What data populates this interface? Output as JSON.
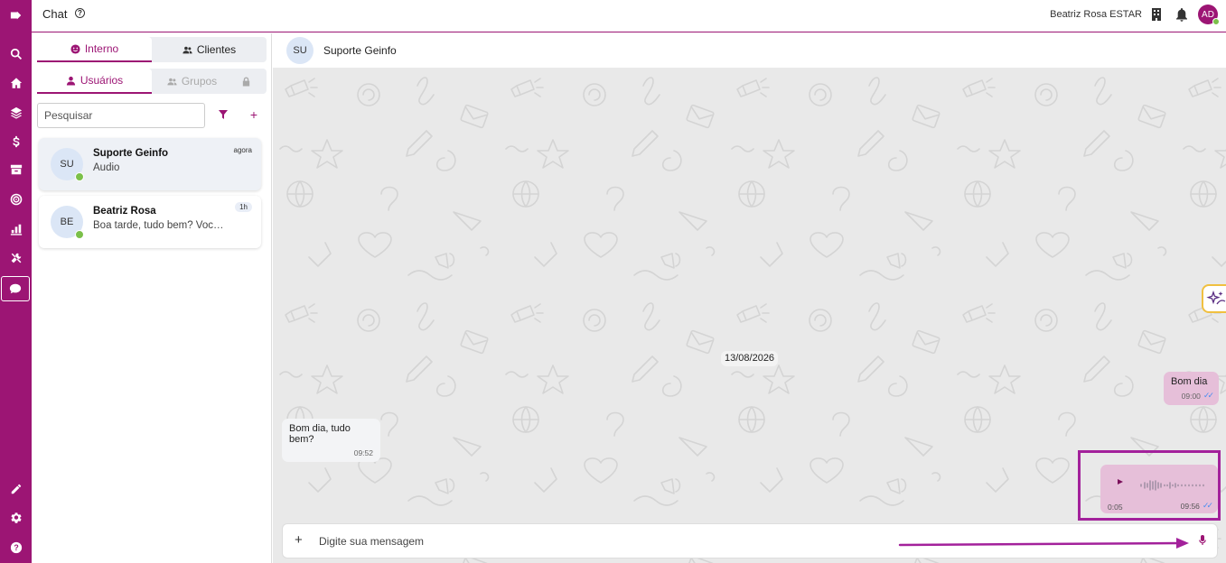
{
  "app": {
    "title": "Chat",
    "user_name": "Beatriz Rosa ESTAR",
    "avatar_initials": "AD",
    "brand_color": "#9c1574"
  },
  "rail": {
    "icons": [
      "menu-expand-icon",
      "search-icon",
      "home-icon",
      "layers-icon",
      "dollar-icon",
      "archive-icon",
      "target-icon",
      "chart-icon",
      "tools-icon",
      "chat-icon",
      "pencil-icon",
      "gear-icon",
      "help-icon"
    ],
    "active": "chat-icon"
  },
  "tabs": {
    "interno": "Interno",
    "clientes": "Clientes"
  },
  "subtabs": {
    "usuarios": "Usuários",
    "grupos": "Grupos"
  },
  "search": {
    "placeholder": "Pesquisar"
  },
  "conversations": [
    {
      "initials": "SU",
      "name": "Suporte Geinfo",
      "preview": "Áudio",
      "time": "agora",
      "online": true
    },
    {
      "initials": "BE",
      "name": "Beatriz Rosa",
      "preview": "Boa tarde, tudo bem? Você c...",
      "time": "1h",
      "online": true
    }
  ],
  "chat": {
    "contact_initials": "SU",
    "contact_name": "Suporte Geinfo",
    "date_divider": "13/08/2026",
    "messages": [
      {
        "direction": "out",
        "text": "Bom dia",
        "time": "09:00"
      },
      {
        "direction": "in",
        "text": "Bom dia, tudo bem?",
        "time": "09:52"
      },
      {
        "direction": "out",
        "type": "audio",
        "duration": "0:05",
        "time": "09:56"
      }
    ]
  },
  "composer": {
    "placeholder": "Digite sua mensagem",
    "plus": "+"
  },
  "colors": {
    "online": "#7bc04a",
    "read_ticks": "#4a8ef0",
    "outgoing_bubble": "#e6bfd9",
    "highlight": "#a3219b"
  }
}
